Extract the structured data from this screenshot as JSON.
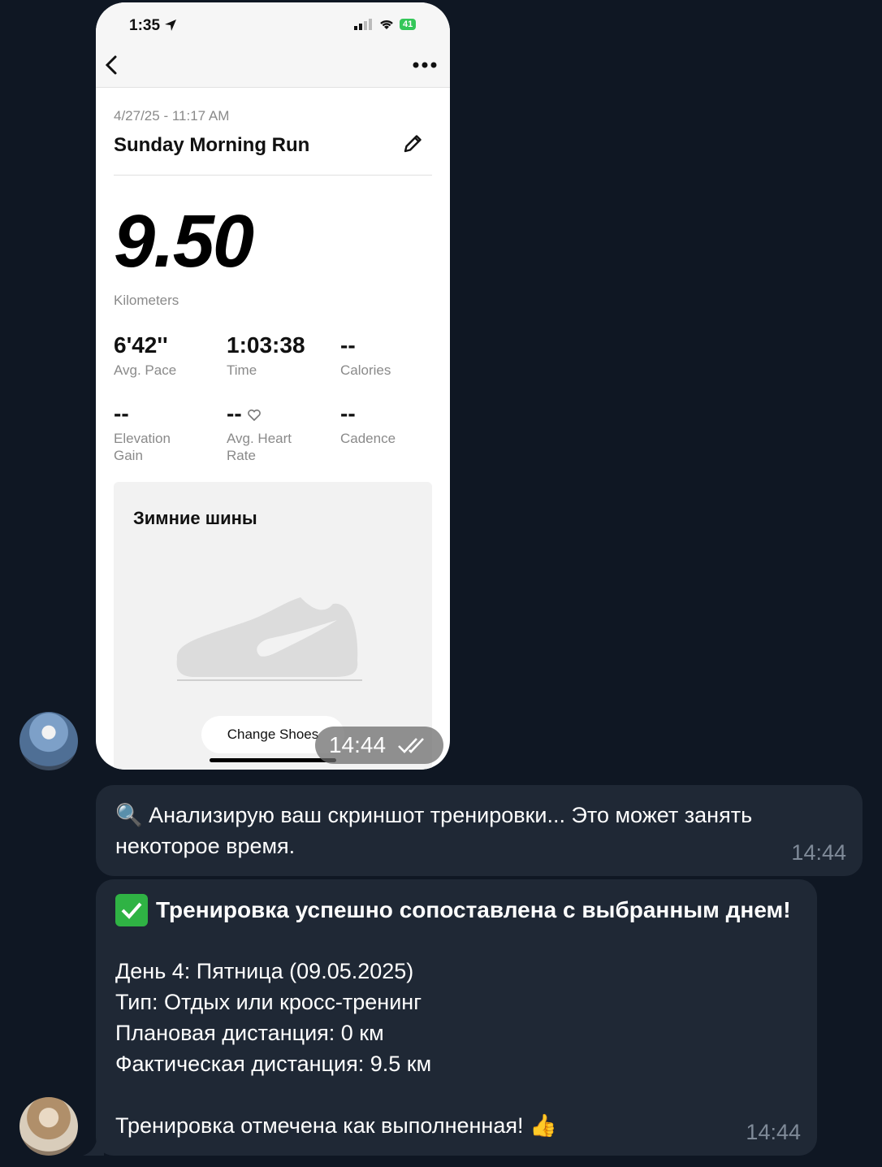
{
  "phone": {
    "status_time": "1:35",
    "battery": "41",
    "workout": {
      "date": "4/27/25 - 11:17 AM",
      "title": "Sunday Morning Run",
      "distance": "9.50",
      "distance_unit": "Kilometers",
      "stats": [
        {
          "value": "6'42''",
          "label": "Avg. Pace"
        },
        {
          "value": "1:03:38",
          "label": "Time"
        },
        {
          "value": "--",
          "label": "Calories"
        },
        {
          "value": "--",
          "label": "Elevation Gain"
        },
        {
          "value": "--",
          "label": "Avg. Heart Rate"
        },
        {
          "value": "--",
          "label": "Cadence"
        }
      ],
      "shoe_name": "Зимние шины",
      "change_shoes_label": "Change Shoes"
    },
    "image_time": "14:44"
  },
  "messages": [
    {
      "text": "🔍 Анализирую ваш скриншот тренировки... Это может занять некоторое время.",
      "time": "14:44"
    },
    {
      "headline": "Тренировка успешно сопоставлена с выбранным днем!",
      "body": "День 4: Пятница (09.05.2025)\nТип: Отдых или кросс-тренинг\nПлановая дистанция: 0 км\nФактическая дистанция: 9.5 км\n\nТренировка отмечена как выполненная! 👍",
      "time": "14:44"
    }
  ],
  "icons": {
    "back": "chevron-left-icon",
    "more": "more-dots-icon",
    "edit": "pencil-icon",
    "heart": "heart-icon",
    "read": "double-check-icon"
  }
}
